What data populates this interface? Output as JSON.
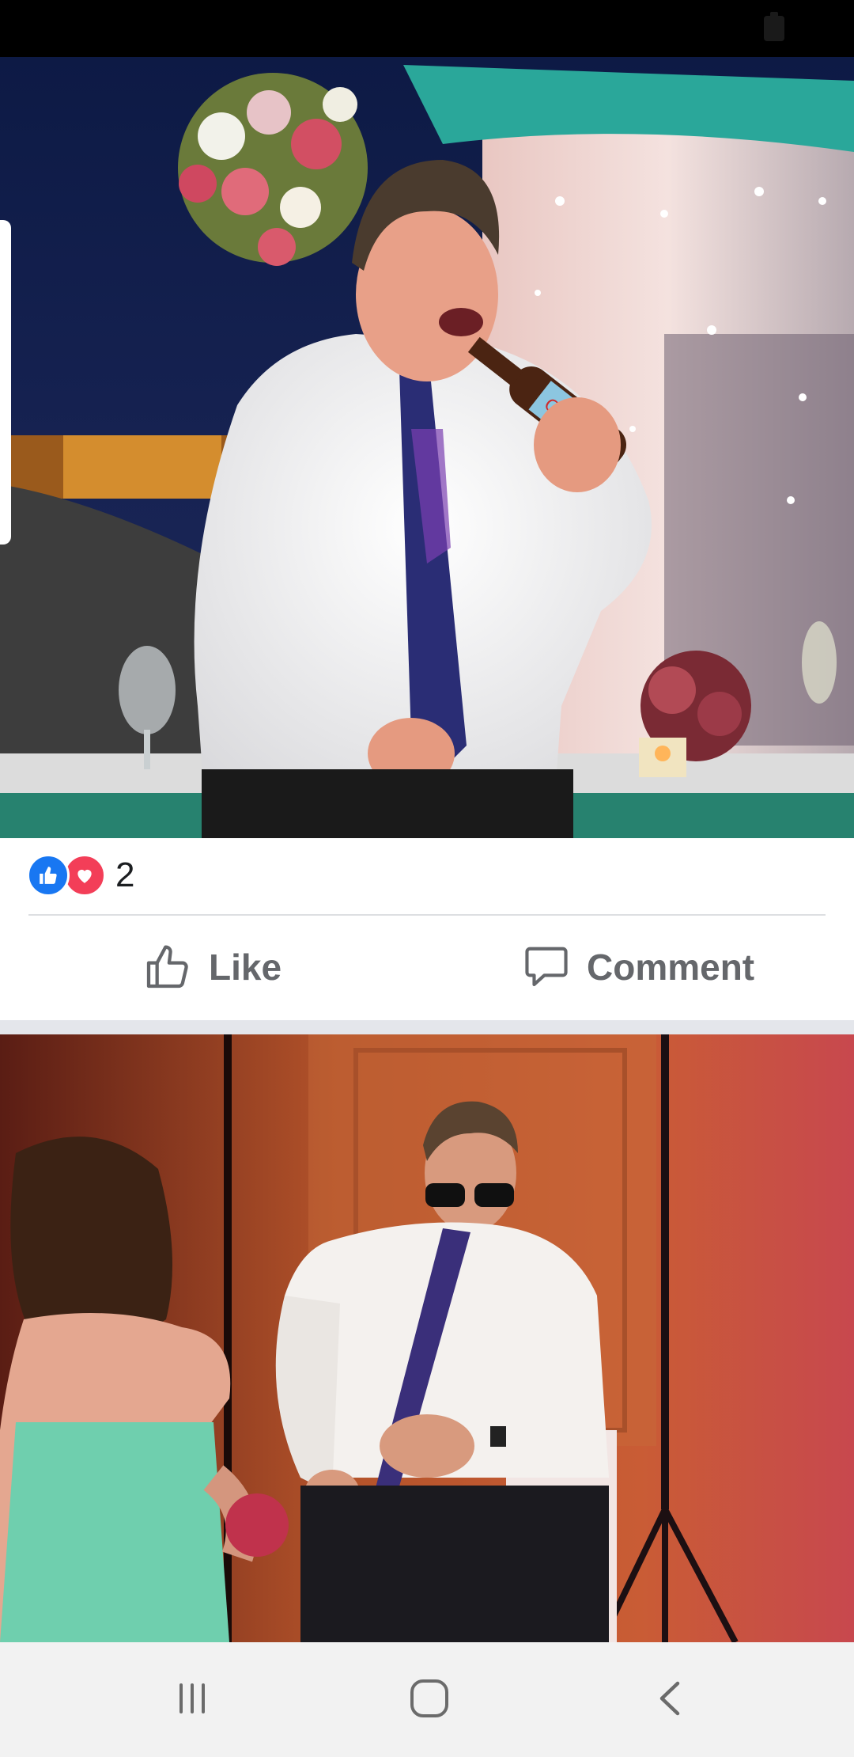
{
  "post": {
    "reactions": {
      "icons": [
        "thumbs-up-icon",
        "heart-icon"
      ],
      "count": "2"
    },
    "actions": {
      "like_label": "Like",
      "comment_label": "Comment"
    }
  },
  "nav": {
    "icons": [
      "recent-apps-icon",
      "home-icon",
      "back-icon"
    ]
  },
  "colors": {
    "like_blue": "#1877f2",
    "love_red": "#f33e58",
    "action_gray": "#65676b"
  }
}
